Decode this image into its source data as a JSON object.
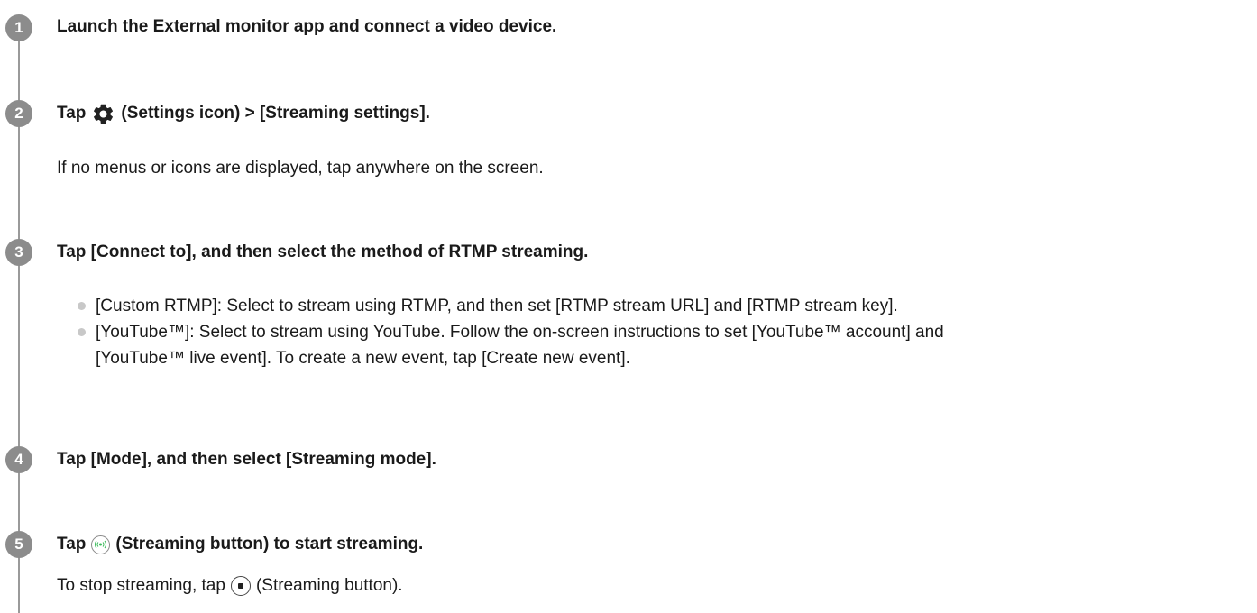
{
  "steps": [
    {
      "number": "1",
      "title": "Launch the External monitor app and connect a video device."
    },
    {
      "number": "2",
      "title_before_icon": "Tap",
      "title_after_icon": "(Settings icon) > [Streaming settings].",
      "note": "If no menus or icons are displayed, tap anywhere on the screen.",
      "icon": "gear-icon"
    },
    {
      "number": "3",
      "title": "Tap [Connect to], and then select the method of RTMP streaming.",
      "bullets": [
        "[Custom RTMP]: Select to stream using RTMP, and then set [RTMP stream URL] and [RTMP stream key].",
        "[YouTube™]: Select to stream using YouTube. Follow the on-screen instructions to set [YouTube™ account] and",
        "[YouTube™ live event]. To create a new event, tap [Create new event]."
      ]
    },
    {
      "number": "4",
      "title": "Tap [Mode], and then select [Streaming mode]."
    },
    {
      "number": "5",
      "title_before_icon": "Tap",
      "title_after_icon": "(Streaming button) to start streaming.",
      "note_before_icon": "To stop streaming, tap",
      "note_after_icon": "(Streaming button).",
      "icon": "streaming-icon",
      "stop_icon": "stop-icon",
      "colors": {
        "streaming_icon": "#3dbb5b",
        "stop_icon": "#222222"
      }
    }
  ],
  "colors": {
    "badge": "#8c8c8c",
    "timeline": "#9a9a9a",
    "bullet": "#c8c8c8",
    "text": "#1a1a1a"
  }
}
